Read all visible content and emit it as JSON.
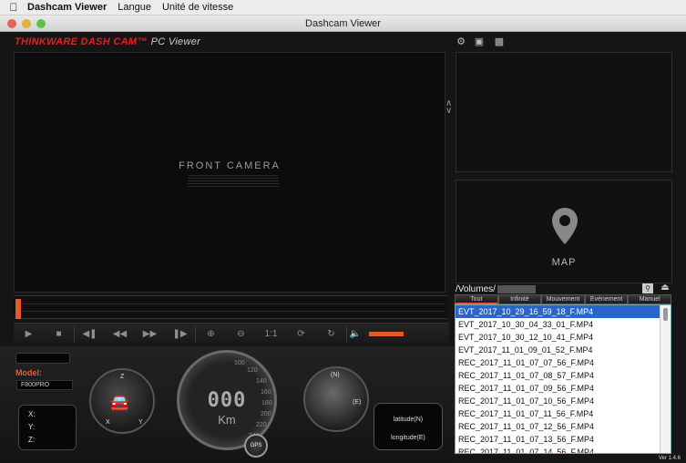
{
  "menubar": {
    "app": "Dashcam Viewer",
    "items": [
      "Langue",
      "Unité de vitesse"
    ]
  },
  "window": {
    "title": "Dashcam Viewer"
  },
  "brand": {
    "name": "THINKWARE DASH CAM™",
    "product": "PC Viewer"
  },
  "video": {
    "label": "FRONT CAMERA"
  },
  "map": {
    "label": "MAP"
  },
  "controls": {
    "ratio": "1:1"
  },
  "dashboard": {
    "model_label": "Model:",
    "model_value": "F800PRO",
    "speed": "000",
    "speed_unit": "Km",
    "gps_label": "GPS",
    "coords": {
      "x": "X:",
      "y": "Y:",
      "z": "Z:"
    },
    "latitude": "latitude(N)",
    "longitude": "longitude(E)",
    "compass_n": "(N)",
    "compass_e": "(E)",
    "accel_z": "Z",
    "accel_x": "X",
    "accel_y": "Y",
    "ticks": [
      "100",
      "120",
      "140",
      "160",
      "180",
      "200",
      "220",
      "240"
    ]
  },
  "files": {
    "path": "/Volumes/",
    "tabs": [
      "Tout",
      "Infinité",
      "Mouvement",
      "Événement",
      "Manuel"
    ],
    "active_tab": 0,
    "items": [
      "EVT_2017_10_29_16_59_18_F.MP4",
      "EVT_2017_10_30_04_33_01_F.MP4",
      "EVT_2017_10_30_12_10_41_F.MP4",
      "EVT_2017_11_01_09_01_52_F.MP4",
      "REC_2017_11_01_07_07_56_F.MP4",
      "REC_2017_11_01_07_08_57_F.MP4",
      "REC_2017_11_01_07_09_56_F.MP4",
      "REC_2017_11_01_07_10_56_F.MP4",
      "REC_2017_11_01_07_11_56_F.MP4",
      "REC_2017_11_01_07_12_56_F.MP4",
      "REC_2017_11_01_07_13_56_F.MP4",
      "REC_2017_11_01_07_14_56_F.MP4"
    ],
    "selected": 0
  },
  "version": "Ver 1.4.6",
  "colors": {
    "accent": "#e55a2a",
    "brand": "#d22222",
    "selection": "#2a66c9"
  }
}
